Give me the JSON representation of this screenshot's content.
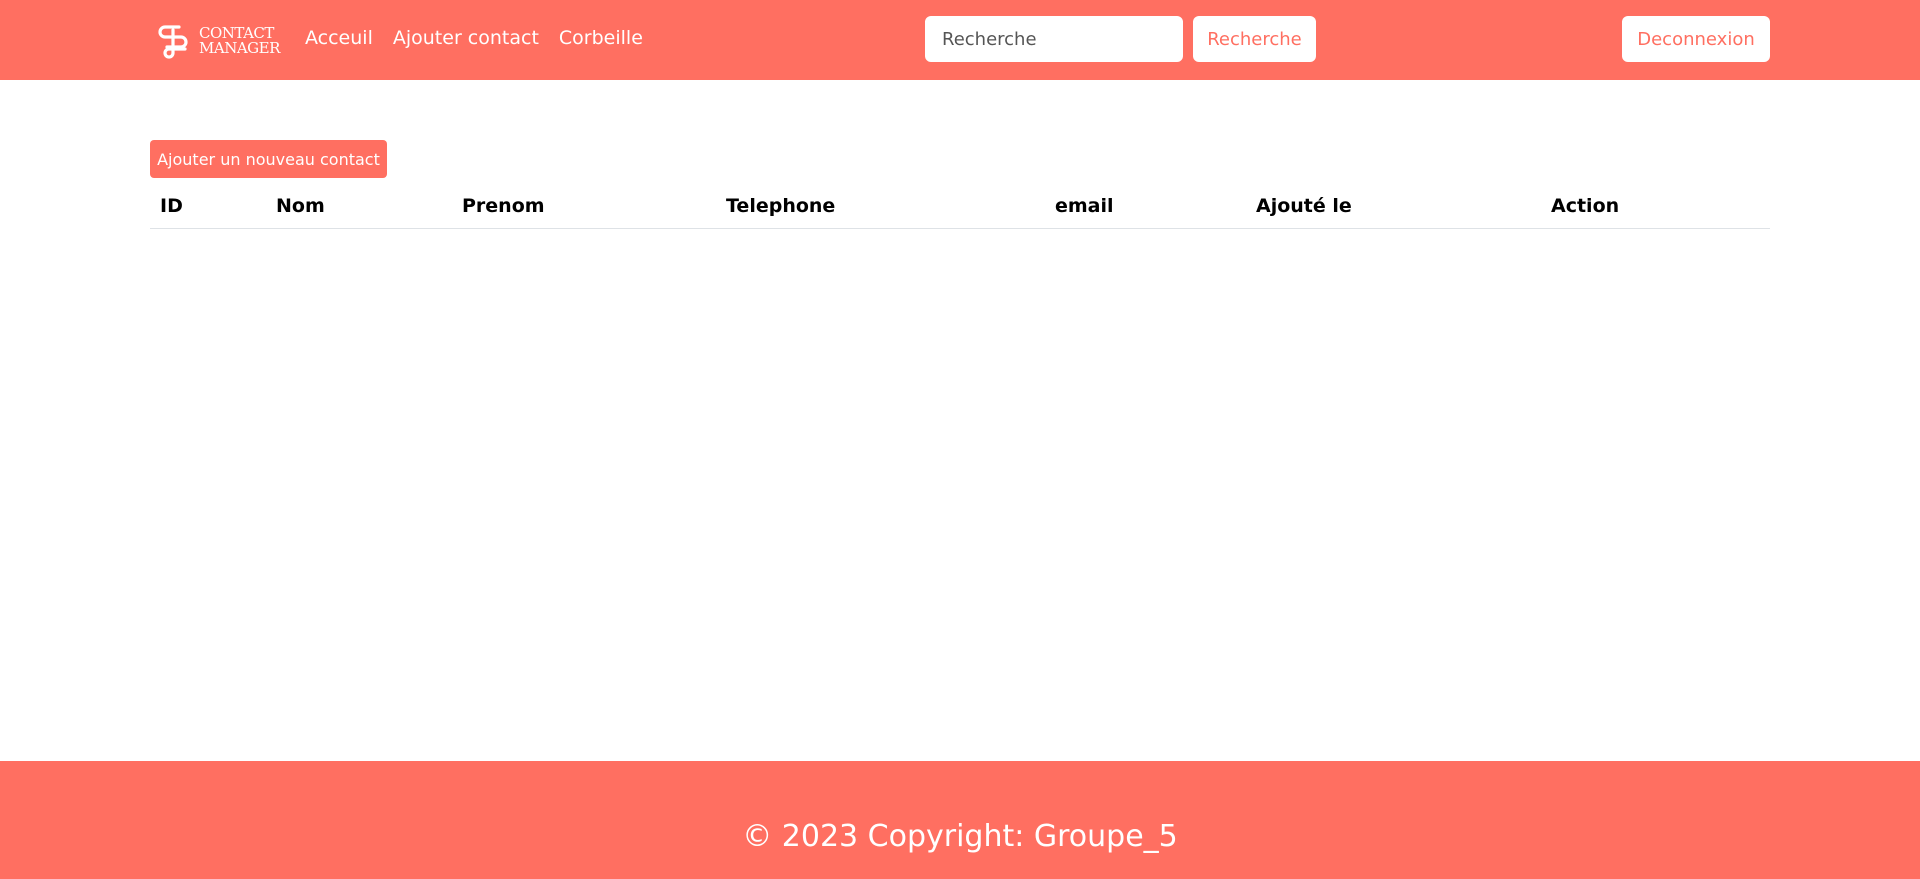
{
  "brand": {
    "line1": "CONTACT",
    "line2": "MANAGER",
    "logo_icon": "infinity-loop-logo"
  },
  "nav": {
    "items": [
      {
        "label": "Acceuil"
      },
      {
        "label": "Ajouter contact"
      },
      {
        "label": "Corbeille"
      }
    ]
  },
  "search": {
    "placeholder": "Recherche",
    "value": "",
    "button_label": "Recherche"
  },
  "logout_label": "Deconnexion",
  "add_contact_label": "Ajouter un nouveau contact",
  "table": {
    "columns": [
      "ID",
      "Nom",
      "Prenom",
      "Telephone",
      "email",
      "Ajouté le",
      "Action"
    ],
    "rows": []
  },
  "footer": {
    "text": "© 2023 Copyright: Groupe_5"
  },
  "colors": {
    "primary": "#ff6f61",
    "white": "#ffffff",
    "text": "#000000"
  }
}
